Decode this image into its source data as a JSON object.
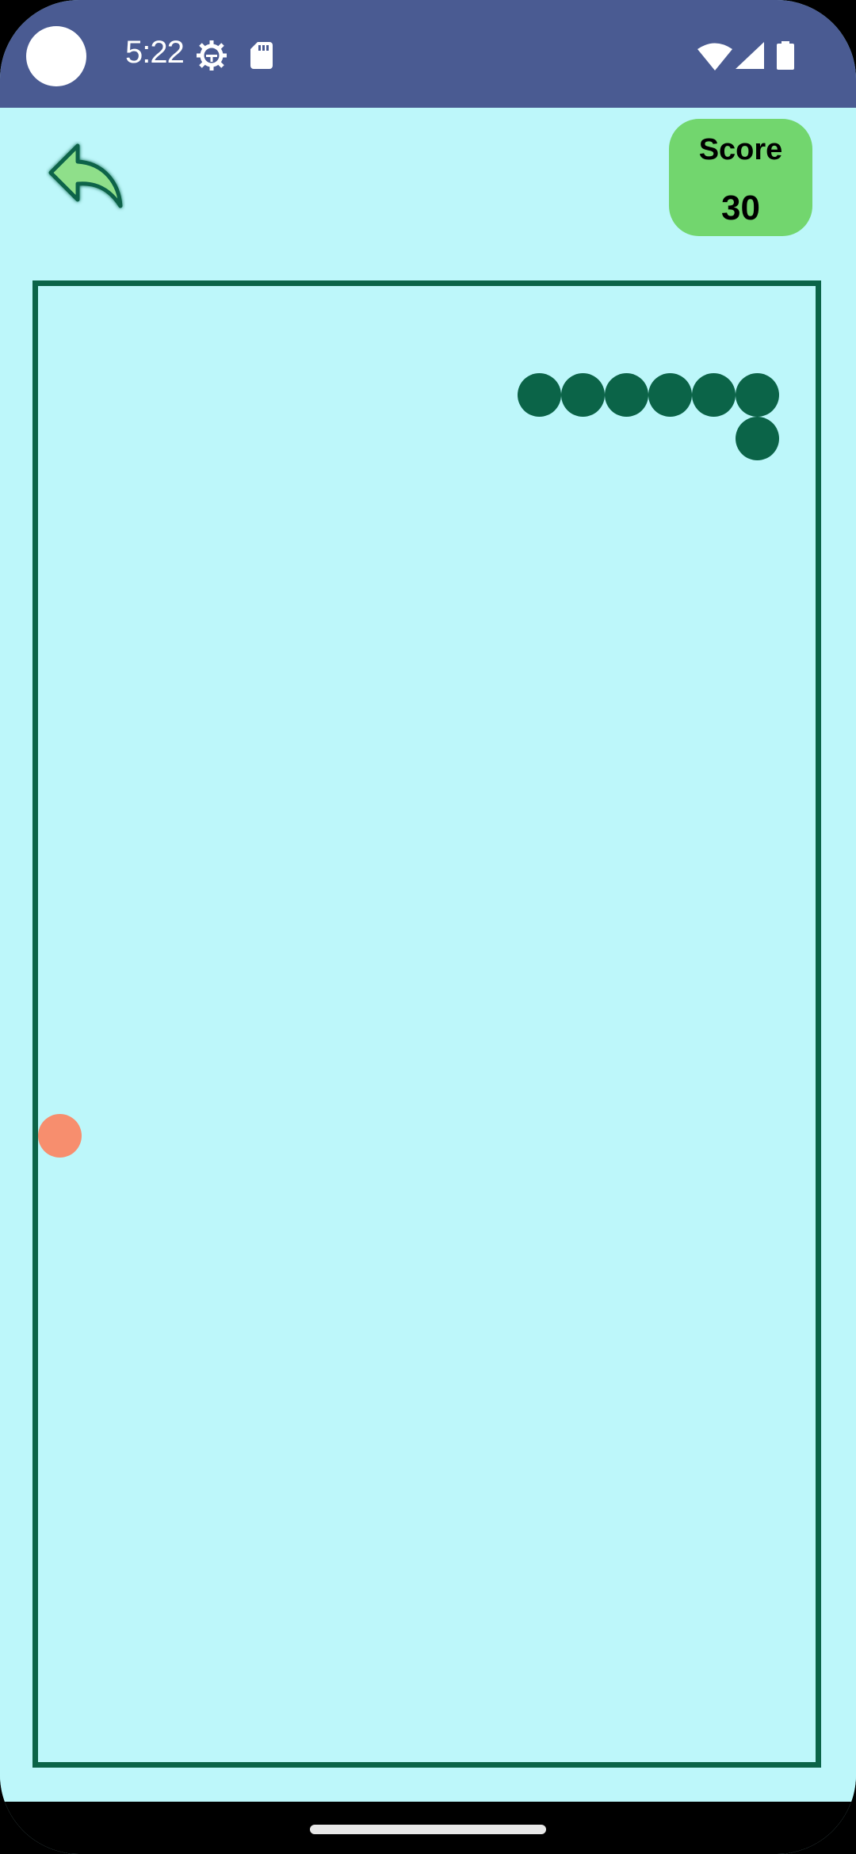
{
  "status_bar": {
    "time": "5:22",
    "icons": [
      "settings-gear-icon",
      "sd-card-icon",
      "wifi-icon",
      "cellular-signal-icon",
      "battery-icon"
    ],
    "background": "#4a5b92"
  },
  "header": {
    "back_icon": "back-arrow-icon",
    "score_label": "Score",
    "score_value": "30"
  },
  "game": {
    "grid_cols": 18,
    "grid_rows": 34,
    "snake": [
      [
        11,
        2
      ],
      [
        12,
        2
      ],
      [
        13,
        2
      ],
      [
        14,
        2
      ],
      [
        15,
        2
      ],
      [
        16,
        2
      ],
      [
        16,
        3
      ]
    ],
    "food": [
      0,
      19
    ],
    "colors": {
      "background": "#bdf7fa",
      "board_border": "#0b6448",
      "snake": "#0b6448",
      "food": "#f78e6e",
      "score_box": "#72d66e"
    }
  }
}
